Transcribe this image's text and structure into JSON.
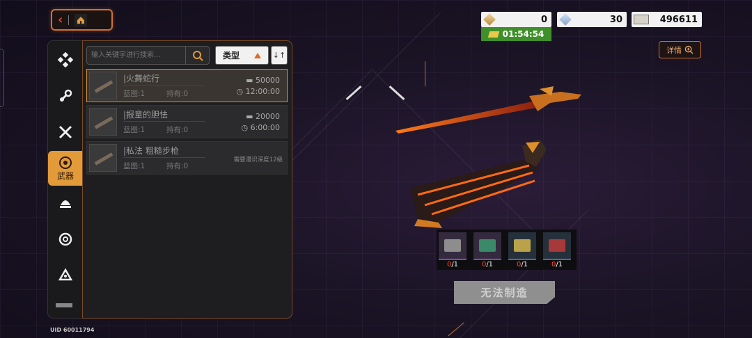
{
  "currencies": [
    {
      "icon": "gold-gem-icon",
      "value": "0"
    },
    {
      "icon": "silver-gem-icon",
      "value": "30"
    },
    {
      "icon": "cash-icon",
      "value": "496611"
    }
  ],
  "timer": {
    "value": "01:54:54"
  },
  "detail_button": {
    "label": "详情"
  },
  "sidebar": {
    "active_label": "武器",
    "items": [
      "diamond-cluster-icon",
      "wrench-icon",
      "crossed-tools-icon",
      "weapons-icon",
      "helmet-icon",
      "spiral-icon",
      "radiation-icon"
    ]
  },
  "search": {
    "placeholder": "输入关键字进行搜索..."
  },
  "filter": {
    "label": "类型"
  },
  "recipes": [
    {
      "name": "|火舞蛇行",
      "blueprint": "蓝图:1",
      "owned": "持有:0",
      "cost": "50000",
      "time": "12:00:00",
      "selected": true
    },
    {
      "name": "|报童的胆怯",
      "blueprint": "蓝图:1",
      "owned": "持有:0",
      "cost": "20000",
      "time": "6:00:00",
      "selected": false
    },
    {
      "name": "|私法 粗糙步枪",
      "blueprint": "蓝图:1",
      "owned": "持有:0",
      "requirement": "需要潜识深度12级",
      "selected": false
    }
  ],
  "materials": [
    "0/1",
    "0/1",
    "0/1",
    "0/1"
  ],
  "craft_button": {
    "label": "无法制造"
  },
  "uid": "UID 60011794",
  "colors": {
    "accent": "#d1712c",
    "timer_green": "#3f8f2b",
    "active_tab": "#e39a39"
  }
}
